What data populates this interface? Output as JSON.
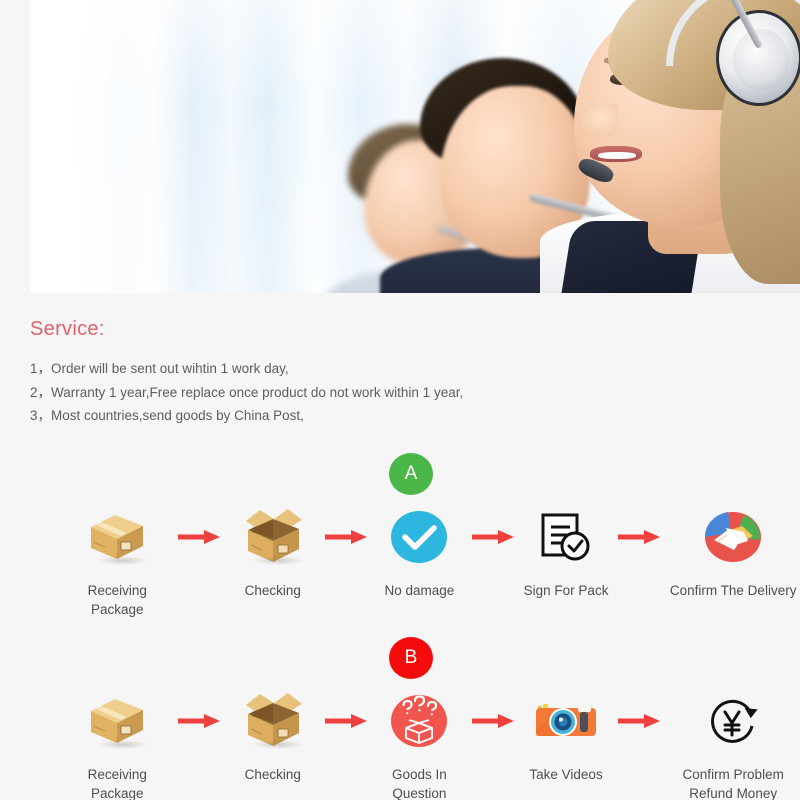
{
  "hero": {
    "alt": "call-center-agents-with-headsets-photo"
  },
  "service": {
    "title": "Service:",
    "lines": [
      "1，Order will be sent out wihtin 1 work day,",
      "2，Warranty 1 year,Free replace once product do not work within 1 year,",
      "3，Most countries,send goods by China Post,"
    ]
  },
  "flows": [
    {
      "badge": "A",
      "badge_color": "#4bb748",
      "steps": [
        {
          "label": "Receiving Package",
          "icon": "closed-parcel-box-icon"
        },
        {
          "label": "Checking",
          "icon": "open-parcel-box-icon"
        },
        {
          "label": "No damage",
          "icon": "blue-check-circle-icon"
        },
        {
          "label": "Sign For Pack",
          "icon": "signed-document-icon"
        },
        {
          "label": "Confirm The Delivery",
          "icon": "handshake-circle-icon"
        }
      ]
    },
    {
      "badge": "B",
      "badge_color": "#f40c0c",
      "steps": [
        {
          "label": "Receiving Package",
          "icon": "closed-parcel-box-icon"
        },
        {
          "label": "Checking",
          "icon": "open-parcel-box-icon"
        },
        {
          "label": "Goods In Question",
          "icon": "question-box-circle-icon"
        },
        {
          "label": "Take Videos",
          "icon": "camera-icon"
        },
        {
          "label": "Confirm Problem\nRefund Money",
          "icon": "yen-refund-icon"
        }
      ]
    }
  ],
  "colors": {
    "page_background": "#f6f6f6",
    "service_title": "#e0616c",
    "body_text": "#5d5d5d",
    "arrow_red": "#ef4040",
    "badge_green": "#4bb748",
    "badge_red": "#f40c0c",
    "check_blue": "#2cb6e0",
    "question_red": "#f2554d",
    "camera_orange": "#f07a36",
    "box_tan": "#e3b96a"
  }
}
